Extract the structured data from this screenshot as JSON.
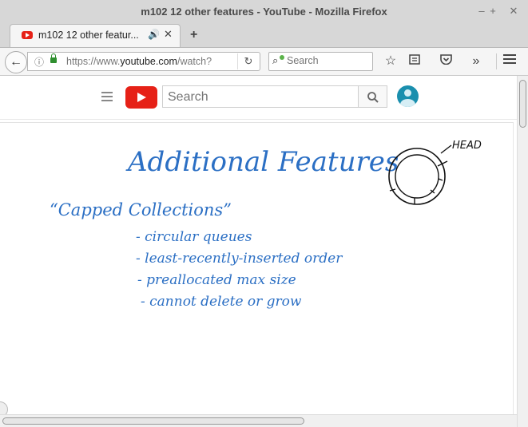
{
  "window": {
    "title": "m102 12 other features - YouTube - Mozilla Firefox",
    "minimize": "–",
    "maximize": "+",
    "close": "✕"
  },
  "tab": {
    "title": "m102 12 other featur...",
    "speaker": "🔊",
    "close": "✕",
    "new_tab": "+"
  },
  "navbar": {
    "back": "←",
    "url_prefix": "https://www.",
    "url_domain": "youtube.com",
    "url_suffix": "/watch?",
    "reload": "↻",
    "search_placeholder": "Search"
  },
  "toolbar_icons": [
    "star-icon",
    "reading-list-icon",
    "pocket-icon",
    "overflow-icon",
    "menu-icon"
  ],
  "youtube": {
    "search_placeholder": "Search",
    "brand_color": "#e62117"
  },
  "video": {
    "heading": "Additional Features",
    "head_label": "HEAD",
    "subheading": "“Capped Collections”",
    "bullets": [
      "- circular queues",
      "- least-recently-inserted order",
      "- preallocated max size",
      "- cannot delete or grow"
    ],
    "ink_color": "#2b6fc4"
  }
}
